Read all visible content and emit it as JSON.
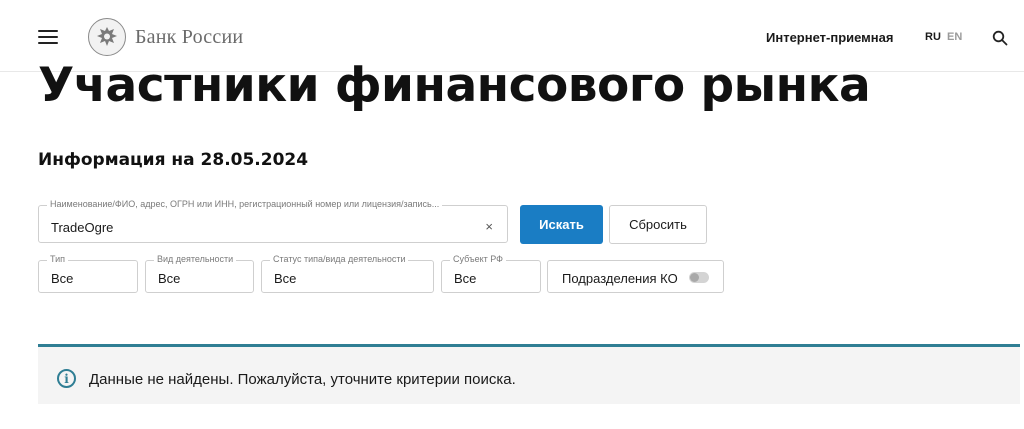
{
  "header": {
    "brand": "Банк России",
    "reception_link": "Интернет-приемная",
    "lang_ru": "RU",
    "lang_en": "EN"
  },
  "page": {
    "title": "Участники финансового рынка",
    "info_date": "Информация на 28.05.2024"
  },
  "search": {
    "legend": "Наименование/ФИО, адрес, ОГРН или ИНН, регистрационный номер или лицензия/запись...",
    "value": "TradeOgre",
    "clear": "×",
    "search_button": "Искать",
    "reset_button": "Сбросить"
  },
  "filters": {
    "type": {
      "legend": "Тип",
      "value": "Все"
    },
    "activity": {
      "legend": "Вид деятельности",
      "value": "Все"
    },
    "status": {
      "legend": "Статус типа/вида деятельности",
      "value": "Все"
    },
    "subject": {
      "legend": "Субъект РФ",
      "value": "Все"
    },
    "ko_divisions": {
      "label": "Подразделения КО",
      "enabled": false
    }
  },
  "notice": {
    "icon": "i",
    "text": "Данные не найдены. Пожалуйста, уточните критерии поиска.",
    "accent_color": "#2f7e94"
  },
  "colors": {
    "primary_button": "#1a7dc4",
    "notice_background": "#f4f4f4"
  }
}
